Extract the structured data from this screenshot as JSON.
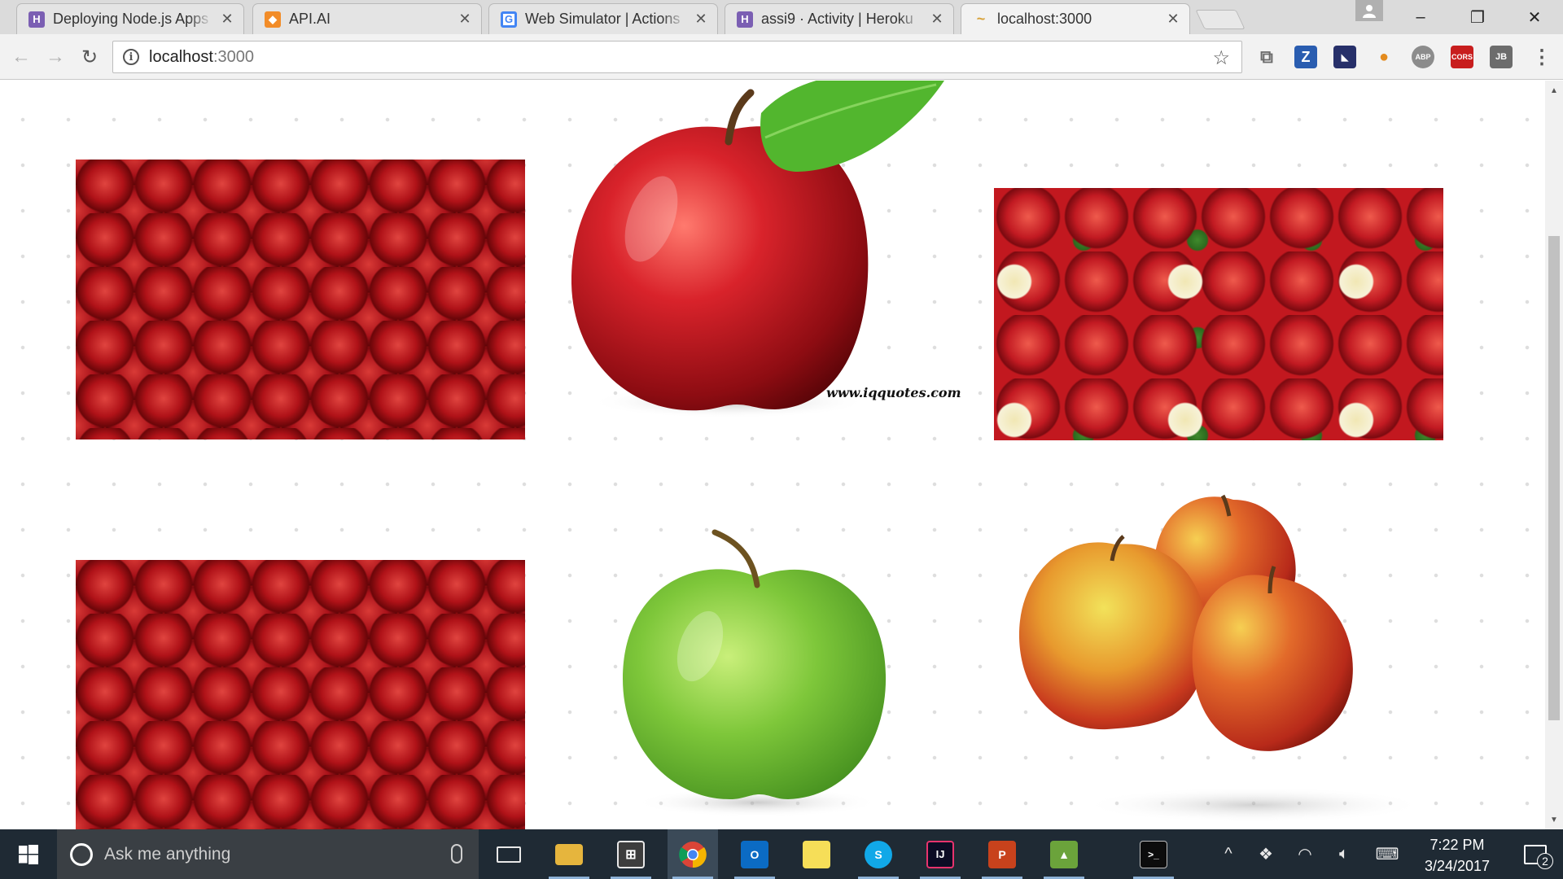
{
  "browser": {
    "tabs": [
      {
        "title": "Deploying Node.js Apps",
        "favicon": "heroku-icon",
        "favicon_color": "#7b5fb3",
        "favicon_glyph": "H"
      },
      {
        "title": "API.AI",
        "favicon": "apiai-icon",
        "favicon_color": "#f28c28",
        "favicon_glyph": "◆"
      },
      {
        "title": "Web Simulator | Actions",
        "favicon": "google-icon",
        "favicon_color": "#4285f4",
        "favicon_glyph": "G"
      },
      {
        "title": "assi9 · Activity | Heroku",
        "favicon": "heroku-icon",
        "favicon_color": "#7b5fb3",
        "favicon_glyph": "H"
      },
      {
        "title": "localhost:3000",
        "favicon": "kangaroo-icon",
        "favicon_color": "#d8a23a",
        "favicon_glyph": "~"
      }
    ],
    "active_tab": 4,
    "address": {
      "host": "localhost",
      "port": ":3000"
    },
    "window_controls": {
      "minimize": "–",
      "restore": "❐",
      "close": "✕"
    }
  },
  "toolbar": {
    "back": "←",
    "forward": "→",
    "reload": "↻",
    "info": "i",
    "star": "☆",
    "extensions": [
      {
        "name": "cast-icon",
        "label": "⧉",
        "color": "#6b6b6b"
      },
      {
        "name": "zotero-icon",
        "label": "Z",
        "color": "#2a5db0"
      },
      {
        "name": "ext-dark-icon",
        "label": "◣",
        "color": "#27306a"
      },
      {
        "name": "ext-flame-icon",
        "label": "●",
        "color": "#e38b1f"
      },
      {
        "name": "adblock-icon",
        "label": "ABP",
        "color": "#8c8c8c"
      },
      {
        "name": "cors-icon",
        "label": "CORS",
        "color": "#c81e1e"
      },
      {
        "name": "jb-icon",
        "label": "JB",
        "color": "#6c6c6c"
      },
      {
        "name": "menu-icon",
        "label": "⋮",
        "color": "#555555"
      }
    ]
  },
  "page": {
    "watermark": "www.iqquotes.com",
    "images": [
      {
        "name": "red-apples-pile-image-1"
      },
      {
        "name": "red-apple-with-leaf-image"
      },
      {
        "name": "red-and-cut-apples-image"
      },
      {
        "name": "red-apples-pile-image-2"
      },
      {
        "name": "green-apple-image"
      },
      {
        "name": "three-apples-image"
      }
    ]
  },
  "taskbar": {
    "search_placeholder": "Ask me anything",
    "apps": [
      {
        "name": "task-view-icon",
        "glyph": "▭",
        "color": "#1f2a34",
        "open": false
      },
      {
        "name": "file-explorer-icon",
        "glyph": "▬",
        "color": "#e6b53d",
        "open": true
      },
      {
        "name": "store-icon",
        "glyph": "⊞",
        "color": "#3d3d3d",
        "open": true
      },
      {
        "name": "chrome-icon",
        "glyph": "●",
        "color": "#d9463b",
        "open": true,
        "active": true
      },
      {
        "name": "outlook-icon",
        "glyph": "O",
        "color": "#0b6bc4",
        "open": true
      },
      {
        "name": "sticky-notes-icon",
        "glyph": "▪",
        "color": "#f6de58",
        "open": false
      },
      {
        "name": "skype-icon",
        "glyph": "S",
        "color": "#11a8e8",
        "open": true
      },
      {
        "name": "intellij-icon",
        "glyph": "IJ",
        "color": "#0c0c24",
        "open": true
      },
      {
        "name": "powerpoint-icon",
        "glyph": "P",
        "color": "#c8421c",
        "open": true
      },
      {
        "name": "image-app-icon",
        "glyph": "▲",
        "color": "#6ba33b",
        "open": true
      },
      {
        "name": "terminal-icon",
        "glyph": ">_",
        "color": "#0c0c0c",
        "open": true
      }
    ],
    "clock": {
      "time": "7:22 PM",
      "date": "3/24/2017"
    },
    "notification_count": "2"
  }
}
